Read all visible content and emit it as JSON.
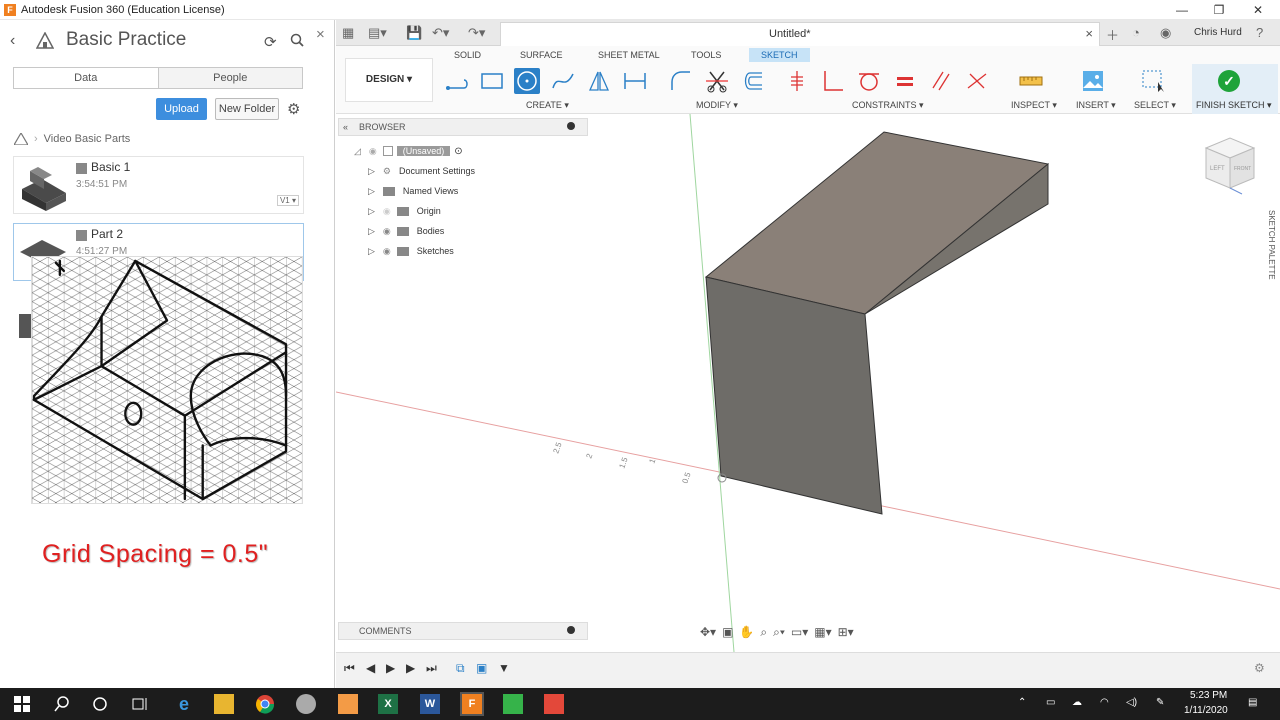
{
  "window": {
    "title": "Autodesk Fusion 360 (Education License)",
    "app_icon_letter": "F",
    "minimize": "—",
    "restore": "❐",
    "close": "✕"
  },
  "data_panel": {
    "project_title": "Basic Practice",
    "tabs": [
      "Data",
      "People"
    ],
    "upload_label": "Upload",
    "new_folder_label": "New Folder",
    "breadcrumb": "Video Basic Parts",
    "items": [
      {
        "name": "Basic 1",
        "time": "3:54:51 PM",
        "version": "V1 ▾"
      },
      {
        "name": "Part 2",
        "time": "4:51:27 PM"
      }
    ],
    "overlay_caption": "Grid Spacing = 0.5\""
  },
  "doc": {
    "tab_title": "Untitled*",
    "user": "Chris Hurd"
  },
  "toolbar": {
    "workspace": "DESIGN ▾",
    "tabs": [
      "SOLID",
      "SURFACE",
      "SHEET METAL",
      "TOOLS",
      "SKETCH"
    ],
    "groups": [
      "CREATE ▾",
      "MODIFY ▾",
      "CONSTRAINTS ▾",
      "INSPECT ▾",
      "INSERT ▾",
      "SELECT ▾"
    ],
    "finish": "FINISH SKETCH ▾"
  },
  "browser": {
    "header": "BROWSER",
    "root": "(Unsaved)",
    "nodes": [
      "Document Settings",
      "Named Views",
      "Origin",
      "Bodies",
      "Sketches"
    ]
  },
  "comments": {
    "header": "COMMENTS"
  },
  "palette": {
    "label": "SKETCH PALETTE"
  },
  "viewcube": {
    "face_left": "LEFT",
    "face_front": "FRONT"
  },
  "axis_ticks": [
    "2.5",
    "2",
    "1.5",
    "1",
    "0.5"
  ],
  "taskbar": {
    "time": "5:23 PM",
    "date": "1/11/2020"
  },
  "colors": {
    "accent": "#2b80c7",
    "finish_green": "#1fa33a",
    "caption_red": "#e02020",
    "body_face_top": "#8a8078",
    "body_face_front": "#6e6c68",
    "body_face_side": "#77736d"
  }
}
